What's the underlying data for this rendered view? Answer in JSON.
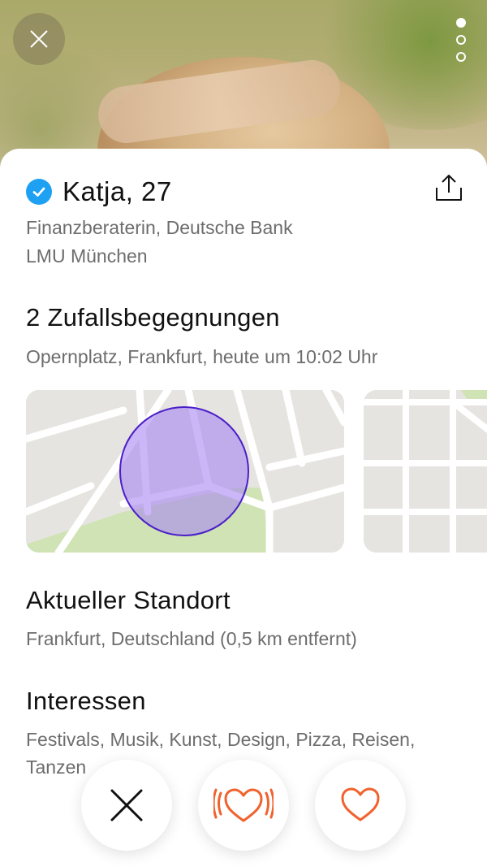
{
  "profile": {
    "name_age": "Katja, 27",
    "job": "Finanzberaterin, Deutsche Bank",
    "school": "LMU München"
  },
  "encounters": {
    "title": "2 Zufallsbegegnungen",
    "detail": "Opernplatz, Frankfurt, heute um 10:02 Uhr"
  },
  "location": {
    "title": "Aktueller Standort",
    "detail": "Frankfurt, Deutschland (0,5 km entfernt)"
  },
  "interests": {
    "title": "Interessen",
    "detail_line1": "Festivals, Musik, Kunst, Design, Pizza, Reisen,",
    "detail_line2": "Tanzen"
  },
  "photo_pager": {
    "count": 3,
    "active_index": 0
  },
  "icons": {
    "close": "close-icon",
    "more": "pager-dots-icon",
    "verified": "verified-check-icon",
    "share": "share-icon",
    "dislike": "x-icon",
    "superlike": "vibrating-heart-icon",
    "like": "heart-icon"
  },
  "colors": {
    "accent": "#f0622e",
    "verified": "#1ea1f2",
    "text_primary": "#111111",
    "text_secondary": "#6d6d6d",
    "map_circle": "#a987f2",
    "map_circle_border": "#4a1fc9"
  }
}
